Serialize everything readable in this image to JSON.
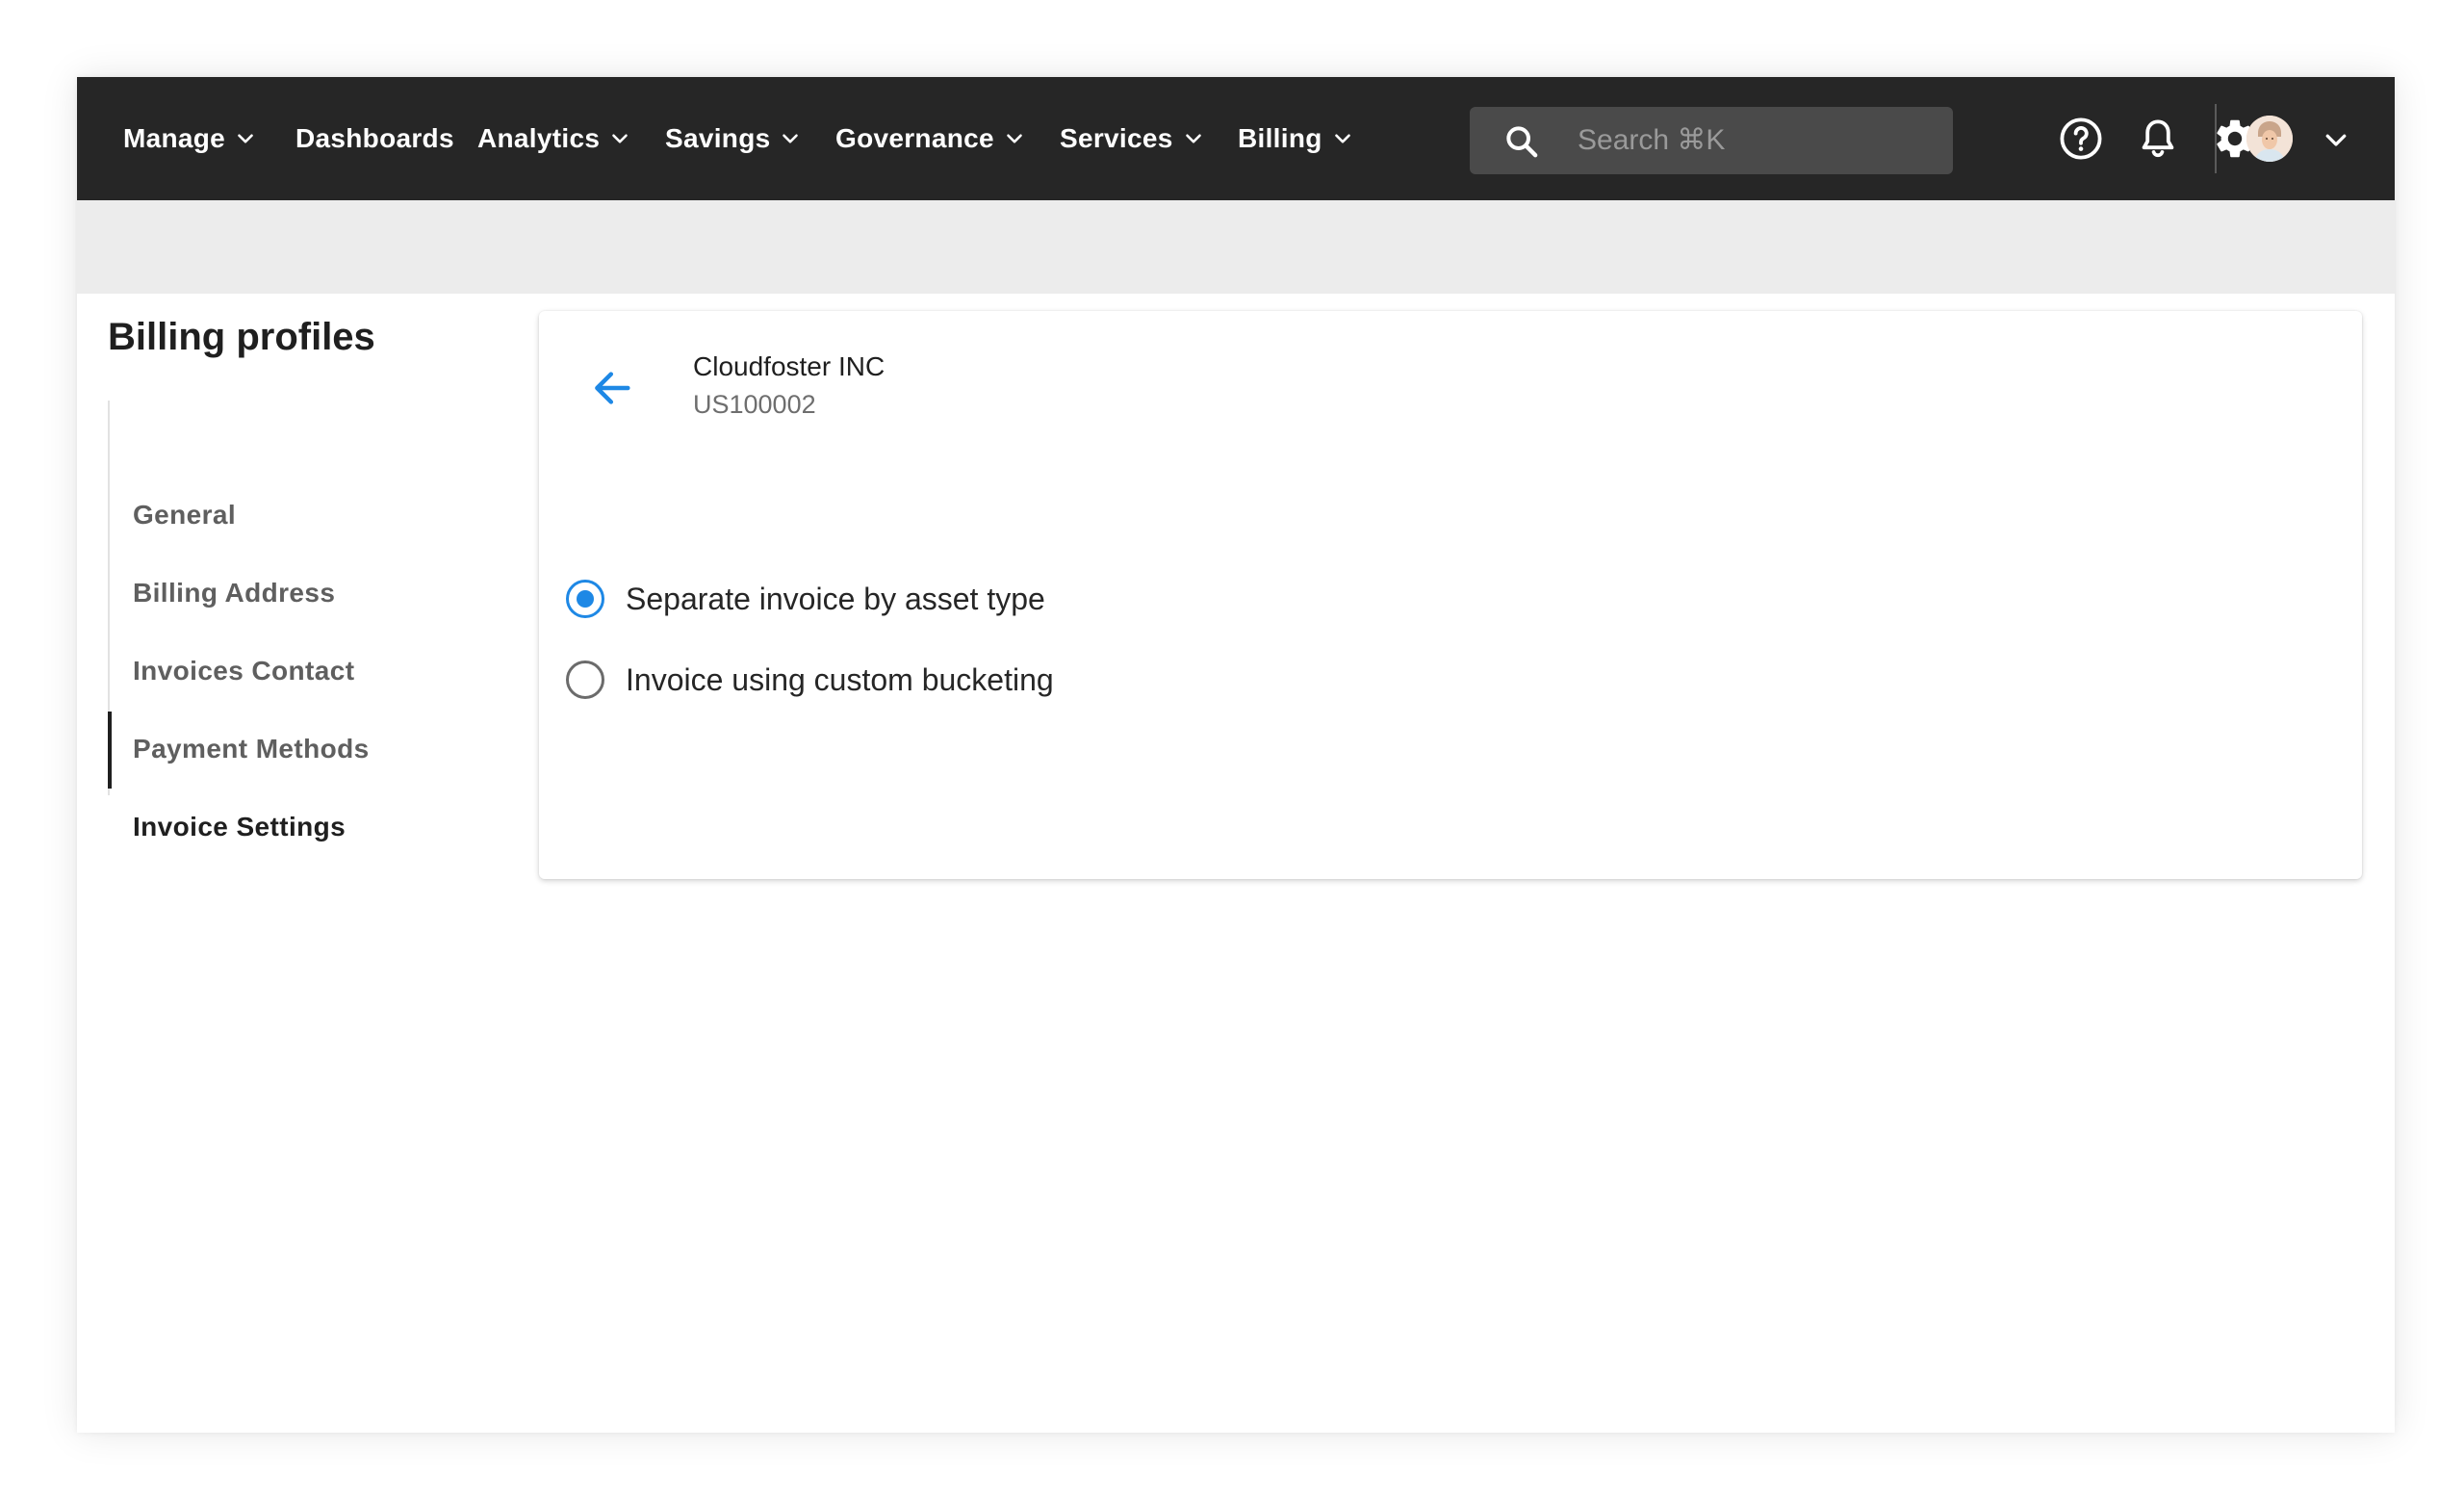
{
  "colors": {
    "topbar": "#262626",
    "accent": "#1e88e5",
    "strip": "#ececec"
  },
  "nav": {
    "items": [
      {
        "label": "Manage",
        "has_menu": true
      },
      {
        "label": "Dashboards",
        "has_menu": false
      },
      {
        "label": "Analytics",
        "has_menu": true
      },
      {
        "label": "Savings",
        "has_menu": true
      },
      {
        "label": "Governance",
        "has_menu": true
      },
      {
        "label": "Services",
        "has_menu": true
      },
      {
        "label": "Billing",
        "has_menu": true
      }
    ],
    "search": {
      "placeholder": "Search ⌘K",
      "value": "",
      "icon": "search-icon"
    },
    "icons": [
      "help-icon",
      "bell-icon",
      "gear-icon"
    ],
    "user_menu_icon": "chevron-down-icon"
  },
  "sidebar": {
    "title": "Billing profiles",
    "items": [
      {
        "label": "General",
        "active": false
      },
      {
        "label": "Billing Address",
        "active": false
      },
      {
        "label": "Invoices Contact",
        "active": false
      },
      {
        "label": "Payment Methods",
        "active": false
      },
      {
        "label": "Invoice Settings",
        "active": true
      }
    ]
  },
  "card": {
    "back_icon": "arrow-left-icon",
    "account_name": "Cloudfoster INC",
    "account_id": "US100002",
    "options": [
      {
        "label": "Separate invoice by asset type",
        "selected": true
      },
      {
        "label": "Invoice using custom bucketing",
        "selected": false
      }
    ]
  }
}
